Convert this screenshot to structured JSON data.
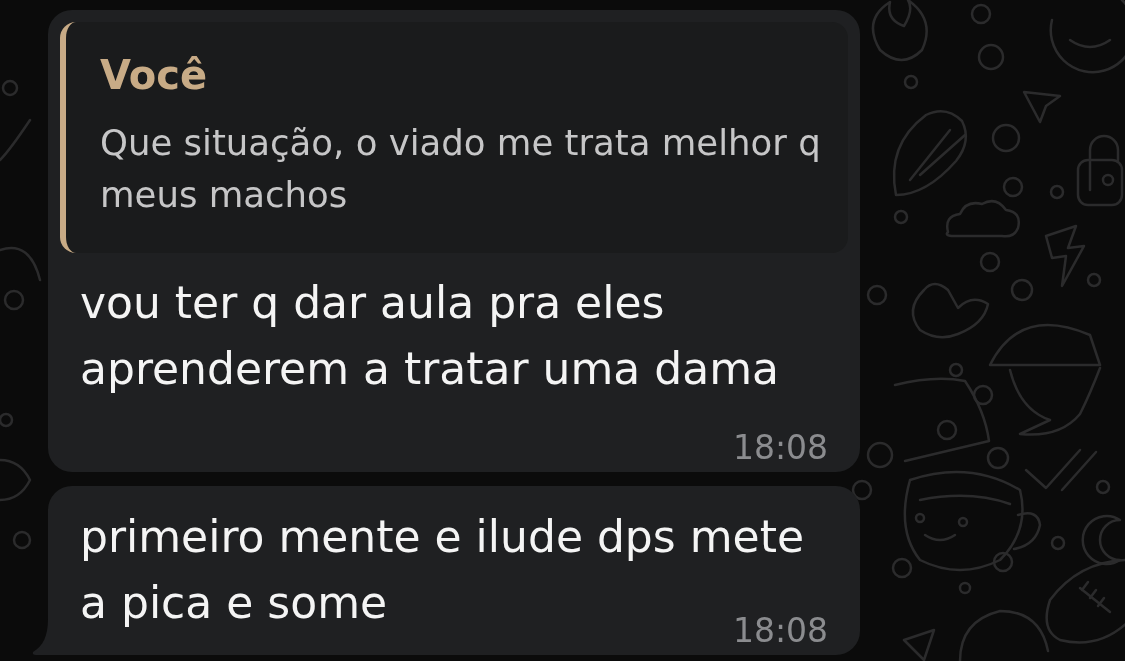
{
  "messages": [
    {
      "quote": {
        "author": "Você",
        "text": "Que situação, o viado me trata melhor q meus machos"
      },
      "text": "vou ter q dar aula pra eles aprenderem a tratar uma dama",
      "time": "18:08",
      "tail": false
    },
    {
      "text": "primeiro mente e ilude dps mete a pica e some",
      "time": "18:08",
      "tail": true
    }
  ]
}
